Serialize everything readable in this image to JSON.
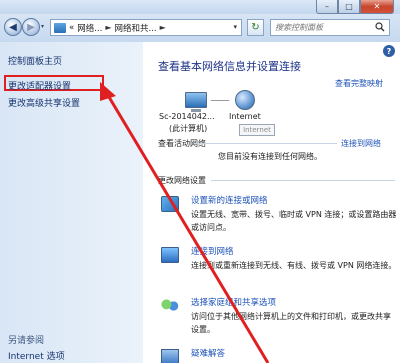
{
  "window": {
    "minimize_glyph": "–",
    "maximize_glyph": "□",
    "close_glyph": "✕"
  },
  "nav": {
    "back_glyph": "◀",
    "forward_glyph": "▶",
    "history_glyph": "▾",
    "breadcrumb": [
      "«",
      "网络...",
      "网络和共...",
      ""
    ],
    "breadcrumb_sep": "►",
    "dropdown_glyph": "▾",
    "refresh_glyph": "↻",
    "search_placeholder": "搜索控制面板",
    "search_icon": "magnifier-icon"
  },
  "sidebar": {
    "home": "控制面板主页",
    "links": [
      "更改适配器设置",
      "更改高级共享设置"
    ],
    "see_also": "另请参阅",
    "see_also_links": [
      "Internet 选项"
    ]
  },
  "main": {
    "help_glyph": "?",
    "title": "查看基本网络信息并设置连接",
    "view_map": "查看完整映射",
    "computer_name": "Sc-2014042...",
    "computer_sub": "(此计算机)",
    "internet_label": "Internet",
    "tooltip": "Internet",
    "active_networks_label": "查看活动网络",
    "connect_link": "连接到网络",
    "no_connection": "您目前没有连接到任何网络。",
    "change_settings_label": "更改网络设置",
    "tasks": [
      {
        "icon": "new-connection-icon",
        "link": "设置新的连接或网络",
        "desc": "设置无线、宽带、拨号、临时或 VPN 连接；或设置路由器或访问点。"
      },
      {
        "icon": "connect-network-icon",
        "link": "连接到网络",
        "desc": "连接到或重新连接到无线、有线、拨号或 VPN 网络连接。"
      },
      {
        "icon": "homegroup-icon",
        "link": "选择家庭组和共享选项",
        "desc": "访问位于其他网络计算机上的文件和打印机，或更改共享设置。"
      },
      {
        "icon": "troubleshoot-icon",
        "link": "疑难解答",
        "desc": ""
      }
    ]
  },
  "annotation": {
    "color": "#e02020"
  }
}
